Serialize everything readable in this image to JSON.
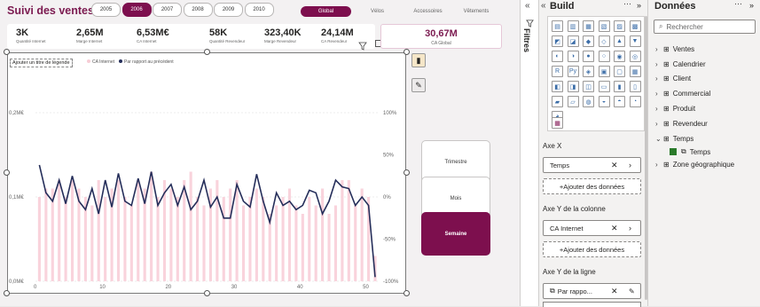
{
  "report": {
    "title": "Suivi des ventes",
    "years": [
      "2005",
      "2006",
      "2007",
      "2008",
      "2009",
      "2010"
    ],
    "selected_year": "2006",
    "segments": [
      "Global",
      "Vélos",
      "Accessoires",
      "Vêtements"
    ],
    "selected_segment": "Global"
  },
  "kpis": [
    {
      "value": "3K",
      "label": "Quantité Internet"
    },
    {
      "value": "2,65M",
      "label": "Marge Internet"
    },
    {
      "value": "6,53M€",
      "label": "CA Internet"
    },
    {
      "value": "58K",
      "label": "Quantité Revendeur"
    },
    {
      "value": "323,40K",
      "label": "Marge Revendeur"
    },
    {
      "value": "24,14M",
      "label": "CA Revendeur"
    }
  ],
  "kpi_global": {
    "value": "30,67M",
    "label": "CA Global"
  },
  "chart": {
    "title_placeholder": "Ajouter un titre de légende",
    "legend": [
      "CA Internet",
      "Par rapport au précédent"
    ],
    "left_ticks": [
      "0,2M€",
      "0,1M€",
      "0,0M€"
    ],
    "right_ticks": [
      "100%",
      "50%",
      "0%",
      "-50%",
      "-100%"
    ],
    "x_ticks": [
      "0",
      "10",
      "20",
      "30",
      "40",
      "50"
    ]
  },
  "granularity": {
    "buttons": [
      "Trimestre",
      "Mois",
      "Semaine"
    ],
    "selected": "Semaine"
  },
  "filters_label": "Filtres",
  "build": {
    "title": "Build",
    "axe_x_label": "Axe X",
    "axe_x_field": "Temps",
    "axe_y_col_label": "Axe Y de la colonne",
    "axe_y_col_field": "CA Internet",
    "add_data": "+Ajouter des données",
    "axe_y_line_label": "Axe Y de la ligne",
    "axe_y_line_field": "Par rappo..."
  },
  "data_pane": {
    "title": "Données",
    "search_placeholder": "Rechercher",
    "tables": [
      "Ventes",
      "Calendrier",
      "Client",
      "Commercial",
      "Produit",
      "Revendeur",
      "Temps",
      "Zone géographique"
    ],
    "temps_child": "Temps"
  },
  "chart_data": {
    "type": "bar",
    "x": [
      1,
      2,
      3,
      4,
      5,
      6,
      7,
      8,
      9,
      10,
      11,
      12,
      13,
      14,
      15,
      16,
      17,
      18,
      19,
      20,
      21,
      22,
      23,
      24,
      25,
      26,
      27,
      28,
      29,
      30,
      31,
      32,
      33,
      34,
      35,
      36,
      37,
      38,
      39,
      40,
      41,
      42,
      43,
      44,
      45,
      46,
      47,
      48,
      49,
      50,
      51,
      52
    ],
    "series": [
      {
        "name": "CA Internet",
        "axis": "left",
        "values": [
          0.1,
          0.11,
          0.11,
          0.12,
          0.1,
          0.12,
          0.11,
          0.1,
          0.09,
          0.12,
          0.1,
          0.11,
          0.12,
          0.1,
          0.09,
          0.12,
          0.11,
          0.13,
          0.1,
          0.12,
          0.11,
          0.1,
          0.12,
          0.13,
          0.1,
          0.09,
          0.11,
          0.12,
          0.1,
          0.11,
          0.12,
          0.09,
          0.1,
          0.11,
          0.1,
          0.08,
          0.09,
          0.1,
          0.11,
          0.09,
          0.08,
          0.1,
          0.09,
          0.11,
          0.08,
          0.09,
          0.12,
          0.12,
          0.09,
          0.11,
          0.1,
          0.03
        ]
      },
      {
        "name": "Par rapport au précédent",
        "axis": "right",
        "values": [
          38,
          5,
          -5,
          20,
          -8,
          25,
          -5,
          -15,
          10,
          -20,
          20,
          -12,
          28,
          -5,
          -10,
          22,
          -8,
          30,
          -10,
          5,
          15,
          -10,
          12,
          -15,
          -5,
          20,
          -12,
          0,
          -25,
          -25,
          15,
          -5,
          -12,
          27,
          -5,
          -30,
          5,
          -10,
          -5,
          -15,
          -10,
          8,
          5,
          -20,
          -5,
          20,
          12,
          10,
          -10,
          0,
          -10,
          -95
        ]
      }
    ],
    "ylim_left": [
      0,
      0.2
    ],
    "ylim_right": [
      -100,
      100
    ],
    "xlim": [
      0,
      52
    ]
  }
}
